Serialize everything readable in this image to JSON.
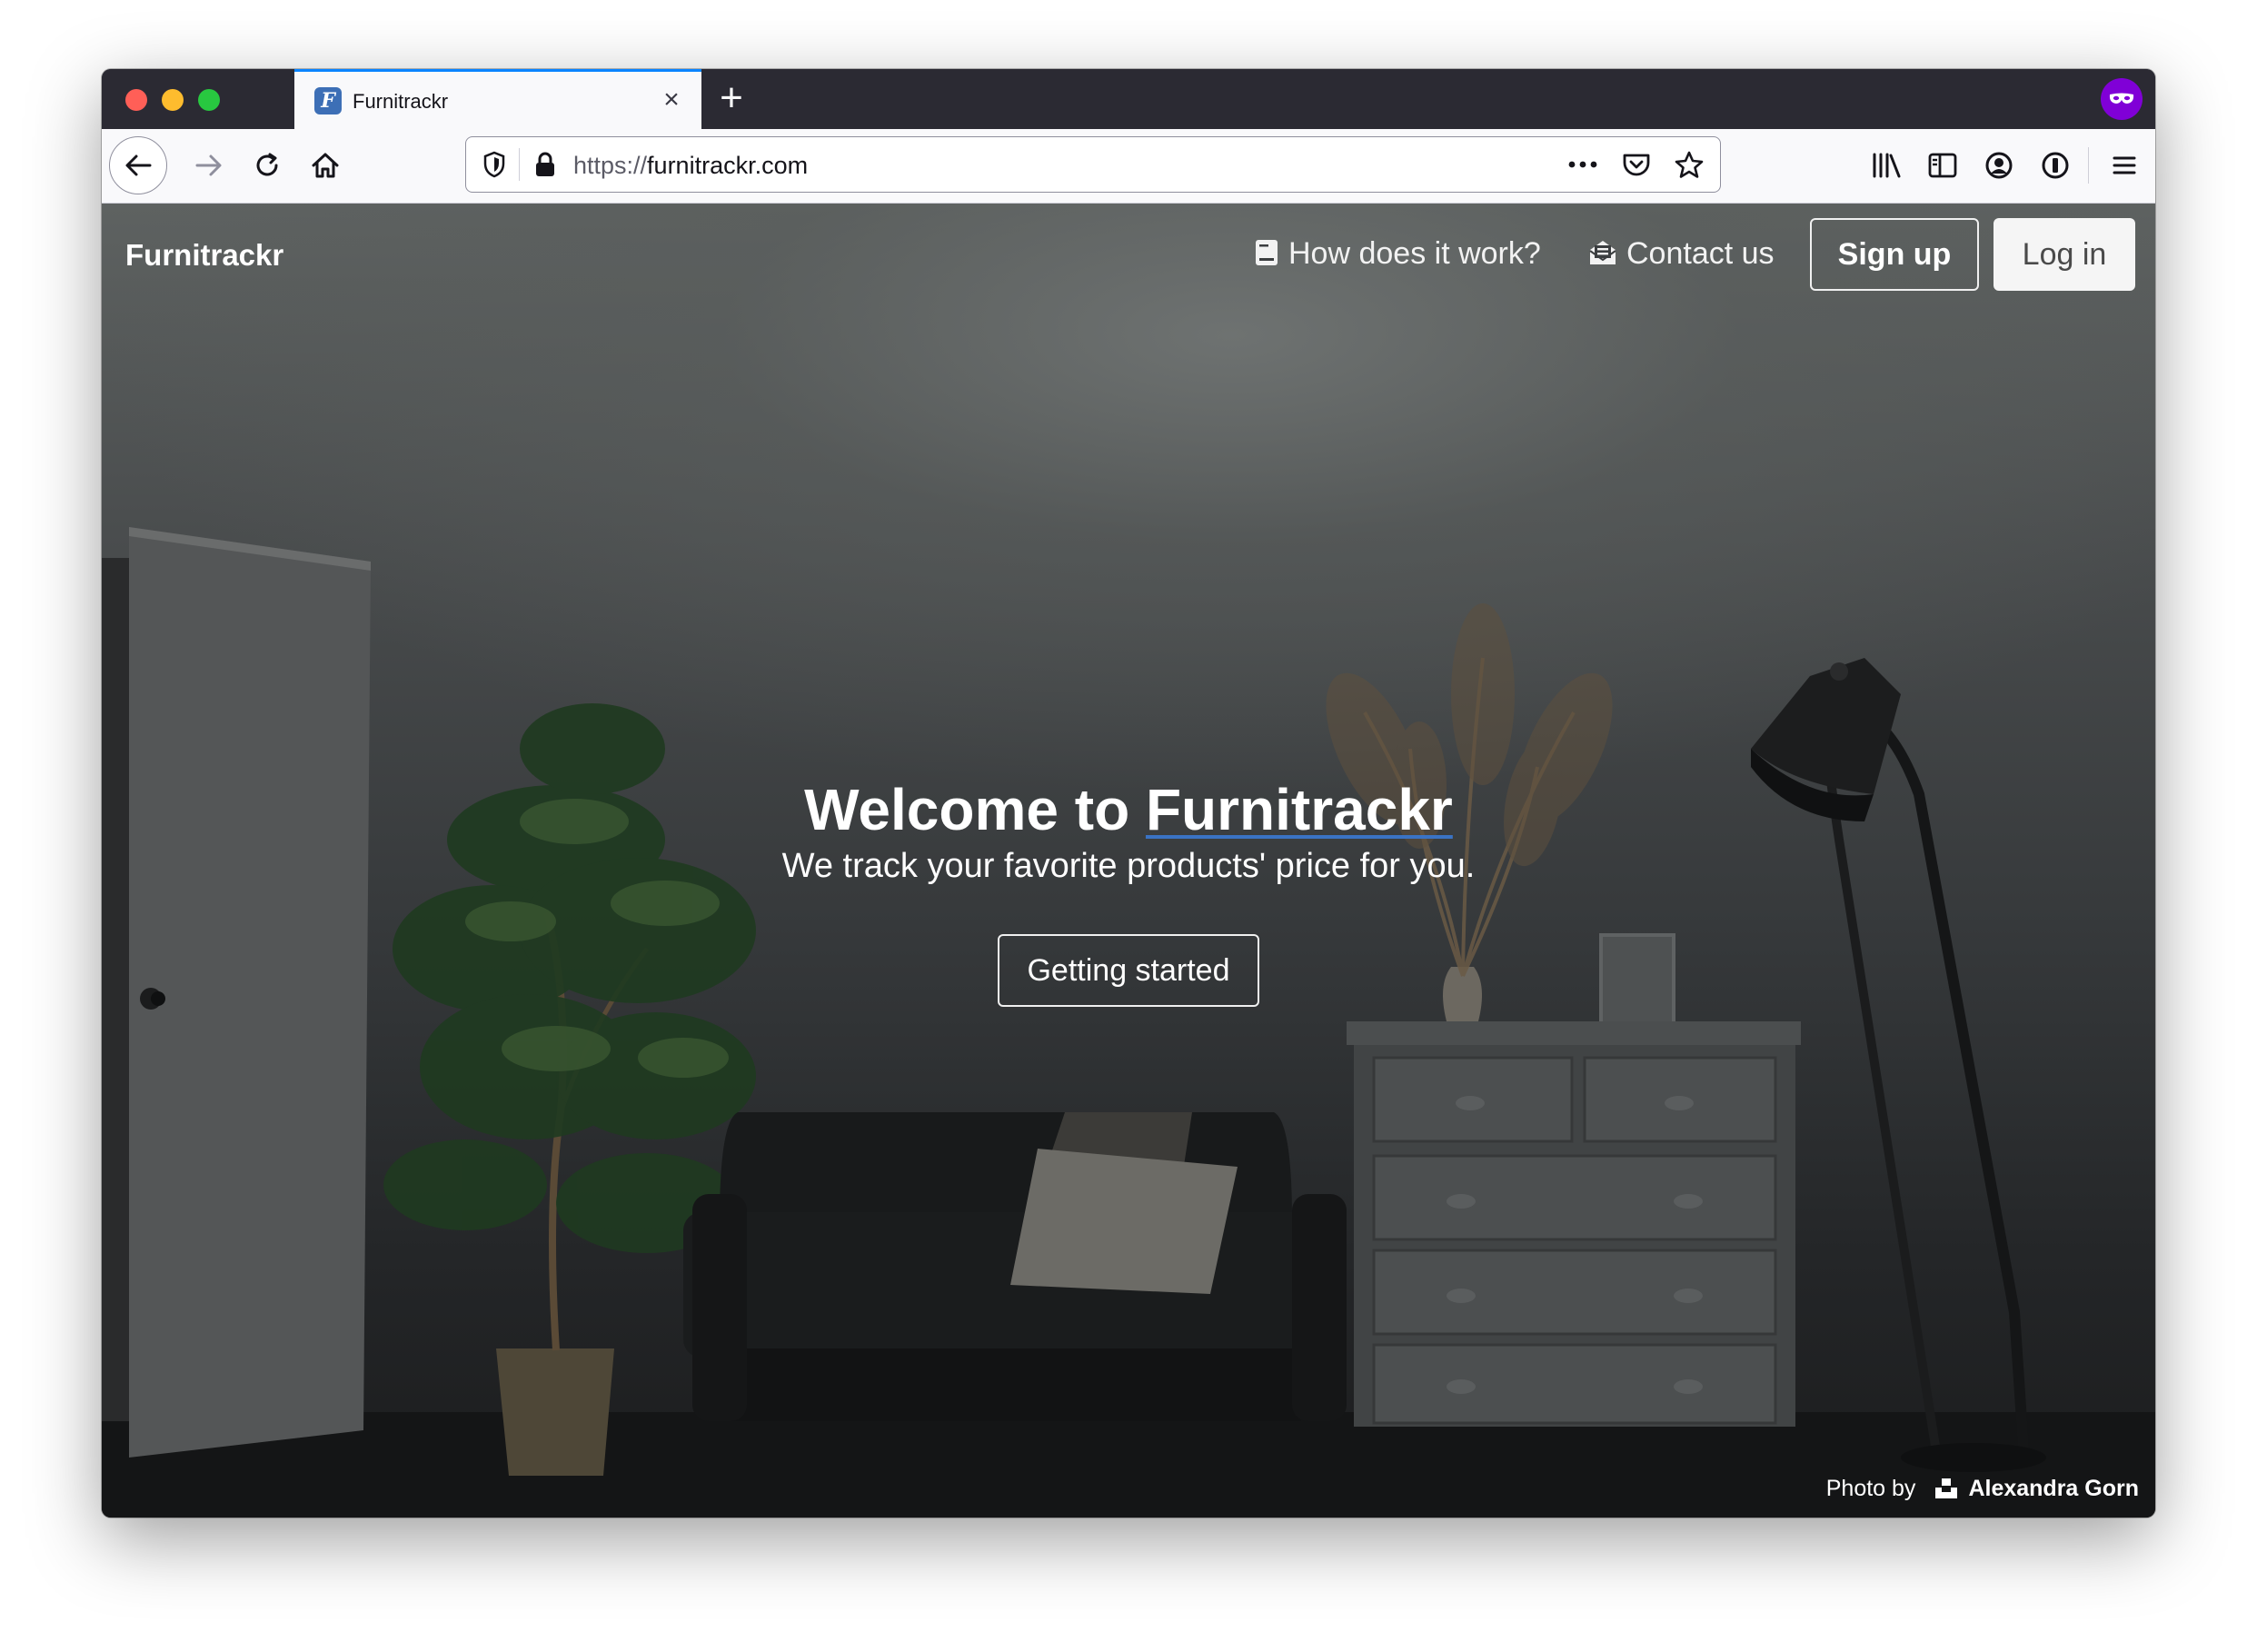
{
  "browser": {
    "tab_title": "Furnitrackr",
    "tab_favicon_letter": "F",
    "url_scheme": "https://",
    "url_host": "furnitrackr.com",
    "accent_color": "#0a84ff",
    "private_badge_color": "#8000d7"
  },
  "site": {
    "brand": "Furnitrackr",
    "nav": {
      "how": "How does it work?",
      "contact": "Contact us",
      "signup": "Sign up",
      "login": "Log in"
    },
    "hero": {
      "title_prefix": "Welcome to ",
      "title_brand": "Furnitrackr",
      "subtitle": "We track your favorite products' price for you.",
      "cta": "Getting started"
    },
    "credit": {
      "prefix": "Photo by",
      "author": "Alexandra Gorn"
    }
  }
}
